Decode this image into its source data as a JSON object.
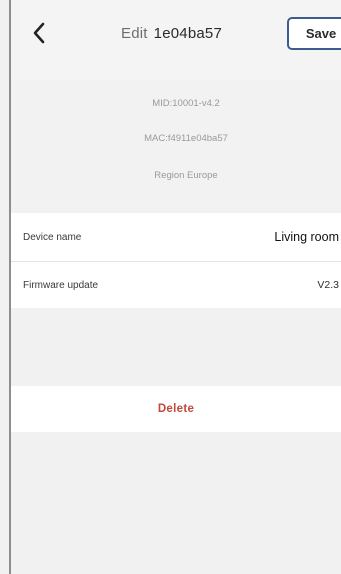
{
  "header": {
    "back_icon": "chevron-left-icon",
    "title_prefix": "Edit",
    "title_id": "1e04ba57",
    "save_label": "Save"
  },
  "info": {
    "mid": "MID:10001-v4.2",
    "mac": "MAC:f4911e04ba57",
    "region": "Region Europe"
  },
  "settings": {
    "device_name": {
      "label": "Device name",
      "value": "Living room"
    },
    "firmware_update": {
      "label": "Firmware update",
      "value": "V2.3"
    }
  },
  "actions": {
    "delete_label": "Delete"
  },
  "colors": {
    "save_border": "#3b5c8f",
    "delete_text": "#c2473c",
    "background": "#f1f1f1"
  }
}
